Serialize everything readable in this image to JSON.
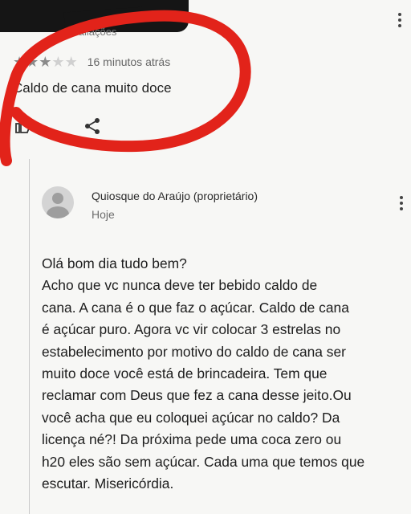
{
  "review": {
    "reviews_count": "avaliações",
    "rating": 3,
    "max_rating": 5,
    "time": "16 minutos atrás",
    "text": "Caldo de cana muito doce"
  },
  "response": {
    "owner": "Quiosque do Araújo (proprietário)",
    "date": "Hoje",
    "lines": [
      "Olá bom dia tudo bem?",
      "Acho que vc nunca deve ter bebido caldo de",
      "cana. A cana é o que faz o açúcar. Caldo de cana",
      "é açúcar puro. Agora vc vir colocar 3 estrelas no",
      "estabelecimento por motivo do caldo de cana ser",
      "muito doce você está de brincadeira. Tem que",
      "reclamar com Deus que fez a cana desse jeito.Ou",
      "você acha que eu coloquei açúcar no caldo? Da",
      "licença né?! Da próxima pede uma coca zero ou",
      "h20 eles são sem açúcar. Cada uma que temos que",
      "escutar. Misericórdia."
    ]
  },
  "icons": {
    "more_top": "more-vert-icon",
    "more_reply": "more-vert-icon",
    "like": "thumb-up-icon",
    "share": "share-icon",
    "avatar": "default-avatar-icon"
  },
  "colors": {
    "annotation": "#e2231a",
    "star_filled": "#8a8a8a",
    "star_empty": "#d0d0d0"
  }
}
